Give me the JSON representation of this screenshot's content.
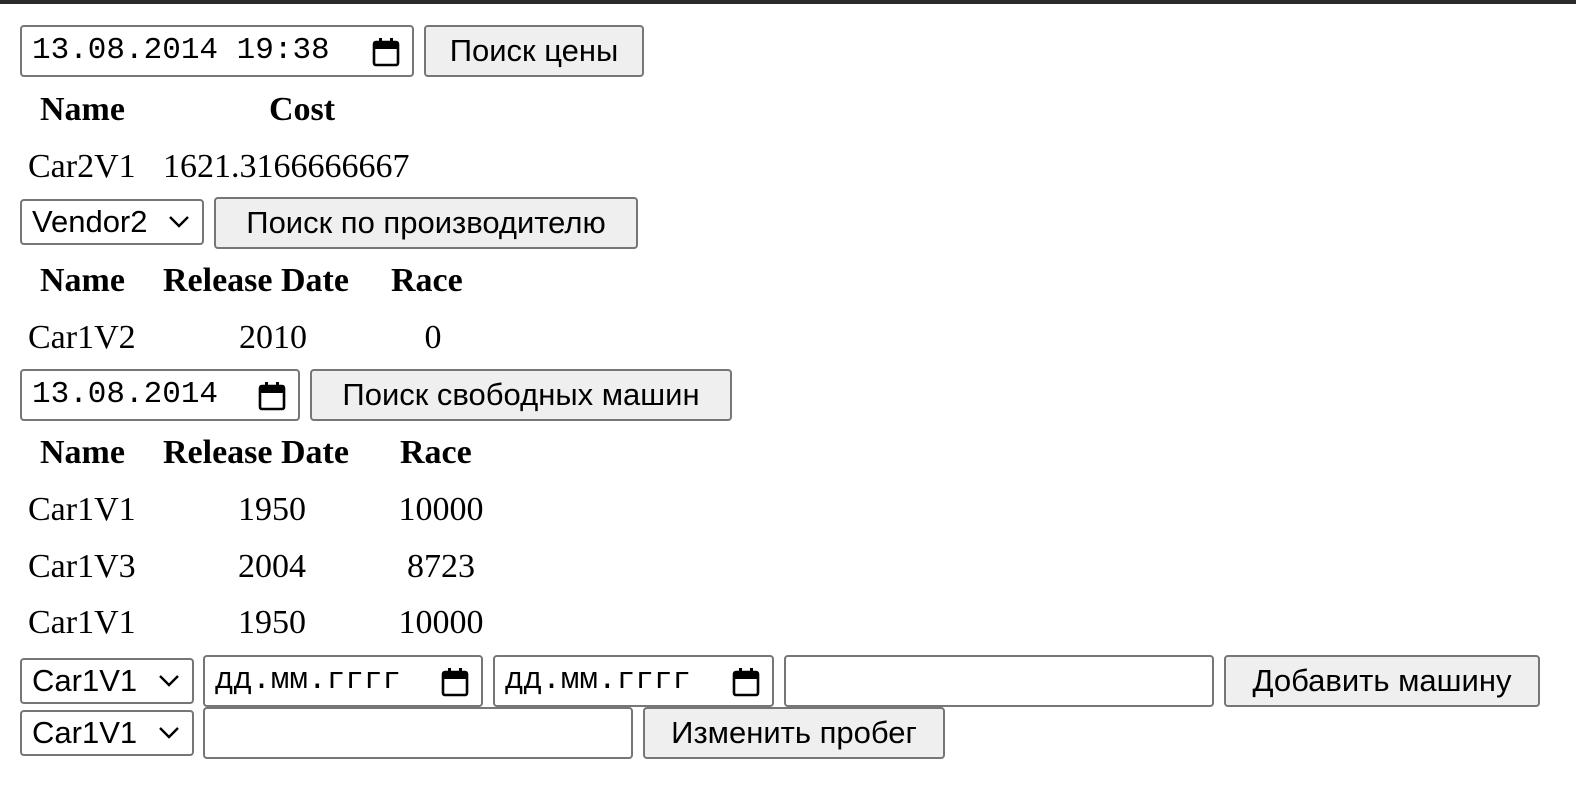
{
  "price_search": {
    "datetime_value": "13.08.2014 19:38",
    "button_label": "Поиск цены",
    "headers": [
      "Name",
      "Cost"
    ],
    "rows": [
      [
        "Car2V1",
        "1621.3166666667"
      ]
    ]
  },
  "vendor_search": {
    "selected_vendor": "Vendor2",
    "button_label": "Поиск по производителю",
    "headers": [
      "Name",
      "Release Date",
      "Race"
    ],
    "rows": [
      [
        "Car1V2",
        "2010",
        "0"
      ]
    ]
  },
  "free_cars_search": {
    "date_value": "13.08.2014",
    "button_label": "Поиск свободных машин",
    "headers": [
      "Name",
      "Release Date",
      "Race"
    ],
    "rows": [
      [
        "Car1V1",
        "1950",
        "10000"
      ],
      [
        "Car1V3",
        "2004",
        "8723"
      ],
      [
        "Car1V1",
        "1950",
        "10000"
      ]
    ]
  },
  "add_car": {
    "selected_car": "Car1V1",
    "start_date_placeholder": "дд.мм.гггг",
    "end_date_placeholder": "дд.мм.гггг",
    "text_value": "",
    "button_label": "Добавить машину"
  },
  "change_mileage": {
    "selected_car": "Car1V1",
    "mileage_value": "",
    "button_label": "Изменить пробег"
  }
}
